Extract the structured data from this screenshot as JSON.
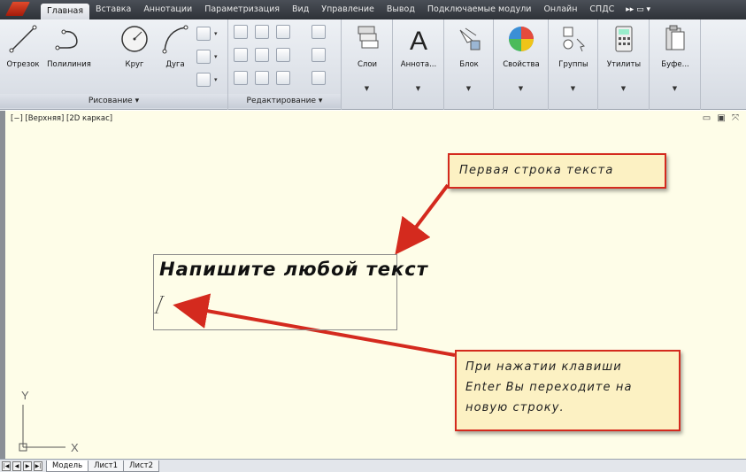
{
  "ribbon_tabs": [
    "Главная",
    "Вставка",
    "Аннотации",
    "Параметризация",
    "Вид",
    "Управление",
    "Вывод",
    "Подключаемые модули",
    "Онлайн",
    "СПДС"
  ],
  "active_tab": "Главная",
  "draw_panel": {
    "title": "Рисование ▾",
    "tools": [
      "Отрезок",
      "Полилиния",
      "Круг",
      "Дуга"
    ]
  },
  "modify_panel": {
    "title": "Редактирование ▾"
  },
  "big_tools": [
    {
      "label": "Слои",
      "icon": "layers-icon"
    },
    {
      "label": "Аннота...",
      "icon": "annotation-icon"
    },
    {
      "label": "Блок",
      "icon": "block-icon"
    },
    {
      "label": "Свойства",
      "icon": "properties-icon"
    },
    {
      "label": "Группы",
      "icon": "groups-icon"
    },
    {
      "label": "Утилиты",
      "icon": "utilities-icon"
    },
    {
      "label": "Буфе...",
      "icon": "clipboard-icon"
    }
  ],
  "viewport_label": "[−] [Верхняя] [2D каркас]",
  "typed_text": "Напишите любой текст",
  "callout_top": "Первая строка текста",
  "callout_bottom": {
    "line1": "При нажатии клавиши",
    "line2": "Enter Вы переходите на",
    "line3": "новую строку."
  },
  "ucs": {
    "y": "Y",
    "x": "X"
  },
  "layout_tabs": [
    "Модель",
    "Лист1",
    "Лист2"
  ],
  "colors": {
    "accent_red": "#d42a1e",
    "canvas": "#fefde8",
    "callout_fill": "#fcf1c3"
  }
}
